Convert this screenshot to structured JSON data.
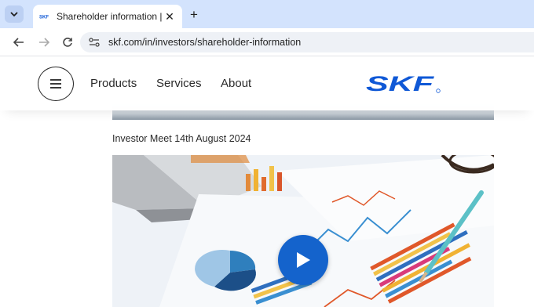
{
  "browser": {
    "tab": {
      "title": "Shareholder information | SKF |",
      "favicon": "skf-favicon-icon"
    },
    "url": "skf.com/in/investors/shareholder-information"
  },
  "header": {
    "nav": [
      "Products",
      "Services",
      "About"
    ],
    "logo_text": "SKF",
    "brand_color": "#0f58d6"
  },
  "main": {
    "section_title": "Investor Meet 14th August 2024",
    "video": {
      "thumbnail": "charts-and-documents-on-desk",
      "play_icon": "play-icon",
      "accent": "#1463cc"
    }
  }
}
